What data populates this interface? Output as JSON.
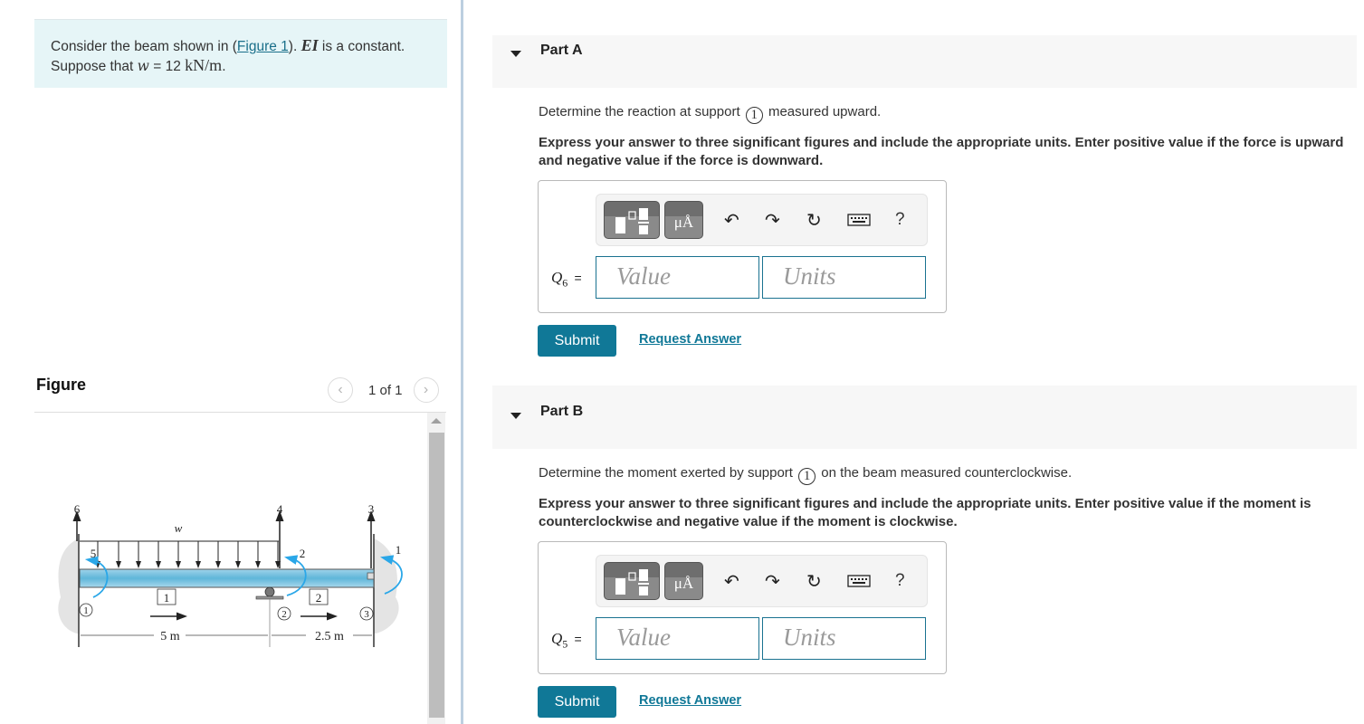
{
  "problem": {
    "text_before_link": "Consider the beam shown in (",
    "figure_link": "Figure 1",
    "text_after_link": "). ",
    "ei_symbol": "EI",
    "ei_text": " is a constant.",
    "line2_prefix": "Suppose that ",
    "w_symbol": "w",
    "w_equals": " = 12 ",
    "w_units": "kN/m",
    "period": "."
  },
  "figure": {
    "title": "Figure",
    "pager": "1 of 1",
    "prev_icon": "chevron-left-icon",
    "next_icon": "chevron-right-icon",
    "labels": {
      "load": "w",
      "dof_6": "6",
      "dof_5": "5",
      "dof_4": "4",
      "dof_3": "3",
      "dof_2": "2",
      "dof_1": "1",
      "node_1": "1",
      "node_2": "2",
      "node_3": "3",
      "elem_1": "1",
      "elem_2": "2",
      "dim_1": "5 m",
      "dim_2": "2.5 m"
    },
    "colors": {
      "beam": "#5fb6d9",
      "moment_arrow": "#2aa7e8"
    }
  },
  "parts": [
    {
      "title": "Part A",
      "question_before": "Determine the reaction at support ",
      "support_number": "1",
      "question_after": " measured upward.",
      "instruction": "Express your answer to three significant figures and include the appropriate units. Enter positive value if the force is upward and negative value if the force is downward.",
      "variable": "Q",
      "subscript": "6",
      "equals": "=",
      "value_placeholder": "Value",
      "units_placeholder": "Units",
      "submit_label": "Submit",
      "request_label": "Request Answer"
    },
    {
      "title": "Part B",
      "question_before": "Determine the moment exerted by support ",
      "support_number": "1",
      "question_after": " on the beam measured counterclockwise.",
      "instruction": "Express your answer to three significant figures and include the appropriate units. Enter positive value if the moment is counterclockwise and negative value if the moment is clockwise.",
      "variable": "Q",
      "subscript": "5",
      "equals": "=",
      "value_placeholder": "Value",
      "units_placeholder": "Units",
      "submit_label": "Submit",
      "request_label": "Request Answer"
    }
  ],
  "toolbar": {
    "units_label": "μÅ",
    "help_label": "?",
    "icons": [
      "templates-icon",
      "units-icon",
      "undo-icon",
      "redo-icon",
      "reset-icon",
      "keyboard-icon",
      "help-icon"
    ]
  },
  "colors": {
    "accent": "#107897",
    "intro_bg": "#e6f5f7",
    "part_header_bg": "#f7f7f7",
    "divider": "#bccfe0"
  }
}
